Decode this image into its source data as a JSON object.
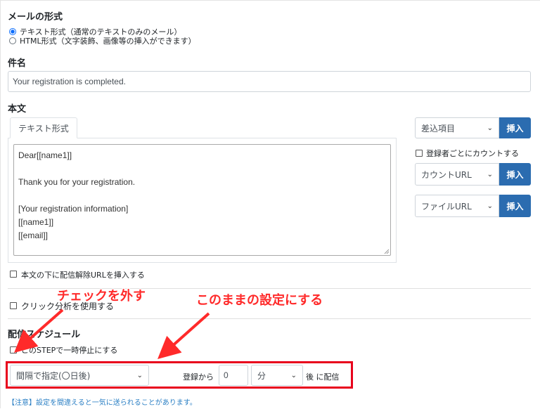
{
  "mail_format": {
    "heading": "メールの形式",
    "options": [
      {
        "label": "テキスト形式（通常のテキストのみのメール）",
        "selected": true
      },
      {
        "label": "HTML形式（文字装飾、画像等の挿入ができます）",
        "selected": false
      }
    ]
  },
  "subject": {
    "heading": "件名",
    "value": "Your registration is completed."
  },
  "body": {
    "heading": "本文",
    "tab_label": "テキスト形式",
    "lines": [
      "Dear[[name1]]",
      "",
      "Thank you for your registration.",
      "",
      "[Your registration information]",
      "[[name1]]",
      "[[email]]"
    ],
    "unsubscribe_checkbox_label": "本文の下に配信解除URLを挿入する"
  },
  "side": {
    "merge_select": "差込項目",
    "insert_label": "挿入",
    "count_checkbox_label": "登録者ごとにカウントする",
    "count_url_select": "カウントURL",
    "file_url_select": "ファイルURL"
  },
  "click_analysis": {
    "label": "クリック分析を使用する"
  },
  "schedule": {
    "heading": "配信スケジュール",
    "pause_label": "このSTEPで一時停止にする",
    "interval_select": "間隔で指定(〇日後)",
    "from_registration": "登録から",
    "amount_value": "0",
    "unit_select": "分",
    "after_label": "後 に配信",
    "note": "【注意】設定を間違えると一気に送られることがあります。"
  },
  "annotations": {
    "uncheck": "チェックを外す",
    "keep": "このままの設定にする"
  },
  "colors": {
    "accent_blue": "#2b6cb0",
    "annotation_red": "#e8001c",
    "note_blue": "#2a7fc4"
  }
}
